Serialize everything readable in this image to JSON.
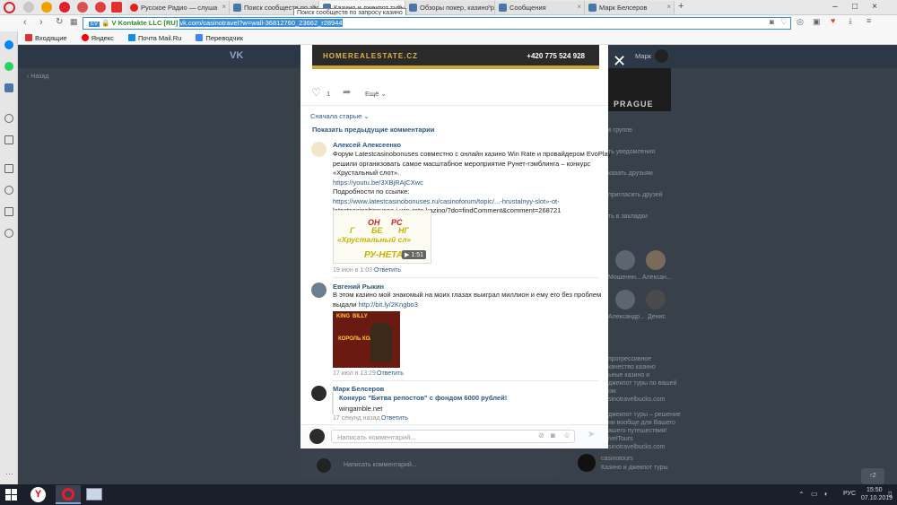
{
  "browser": {
    "tabs": [
      {
        "label": "Русское Радио — слуша"
      },
      {
        "label": "Поиск сообществ по зап"
      },
      {
        "label": "Казино и джекпот туры"
      },
      {
        "label": "Обзоры покер, казино р"
      },
      {
        "label": "Сообщения"
      },
      {
        "label": "Марк Белсеров"
      }
    ],
    "tooltip": "Поиск сообществ по запросу казино",
    "address": {
      "badge": "EV",
      "site_name": "V Kontakte LLC [RU]",
      "url": "vk.com/casinotravel?w=wall-36812760_23662_r28944"
    },
    "bookmarks": [
      "Входящие",
      "Яндекс",
      "Почта Mail.Ru",
      "Переводчик"
    ]
  },
  "banner": {
    "site": "HOMEREALESTATE.CZ",
    "phone": "+420 775 524 928"
  },
  "post_actions": {
    "likes": "1",
    "more": "Ещё"
  },
  "comments": {
    "sort": "Сначала старые",
    "show_previous": "Показать предыдущие комментарии",
    "items": [
      {
        "author": "Алексей Алексеенко",
        "lines": [
          "Форум Latestcasinobonuses совместно с онлайн казино Win Rate и провайдером EvoPlay",
          "решили организовать самое масштабное мероприятие Рунет-гэмблинга – конкурс",
          "«Хрустальный слот»."
        ],
        "link1": "https://youtu.be/3XBjRAjCXwc",
        "more_label": "Подробности по ссылке:",
        "link2": "https://www.latestcasinobonuses.ru/casinoforum/topic/...-hrustalnyy-slot»-ot-",
        "link2_cont": "latestcasinobonuses-i-win-rate-kazino/?do=findComment&comment=268721",
        "video_duration": "1:51",
        "video_text": [
          "ОН",
          "РС",
          "Г",
          "БЕ",
          "НГ",
          "«Хрустальный сл»",
          "РУ-НЕТА"
        ],
        "date": "19 июн в 1:03",
        "reply": "Ответить"
      },
      {
        "author": "Евгений Рыкин",
        "lines": [
          "В этом казино мой знакомый на моих глазах выиграл миллион и ему его без проблем",
          "выдали"
        ],
        "link1": "http://bit.ly/2Kngbo3",
        "image_text": [
          "KING",
          "BILLY",
          "КОРОЛЬ КОЛЕС"
        ],
        "date": "17 июл в 13:29",
        "reply": "Ответить"
      },
      {
        "author": "Марк Белсеров",
        "share_title": "Конкурс \"Битва репостов\" с фондом 6000 рублей!",
        "share_domain": "wingamble.net",
        "date": "17 секунд назад",
        "reply": "Ответить"
      }
    ],
    "input_placeholder": "Написать комментарий..."
  },
  "background": {
    "header_user": "Марк",
    "back_label": "Назад",
    "promo": "PRAGUE",
    "menu": [
      "в группе",
      "ть уведомления",
      "казать друзьям",
      "пригласить друзей",
      "ть в закладки"
    ],
    "friends": [
      "Мошеннн...",
      "Алексан...",
      "Александр...",
      "Денис"
    ],
    "info_lines": [
      "прогрессивное",
      "качество казино",
      "ьные казино и",
      "джекпот туры по вашей",
      "ом",
      "sinotravelbucks.com"
    ],
    "info_lines2": [
      "джекпот туры – решение",
      "ни вообще для Вашего",
      "ашего путешествия!",
      "ivelTours",
      "sinotravelbucks.com"
    ],
    "group_name": "casinotours",
    "group_desc": "Казино и джекпот туры",
    "under_placeholder": "Написать комментарий..."
  },
  "taskbar": {
    "language": "РУС",
    "time": "15:50",
    "date": "07.10.2019"
  }
}
